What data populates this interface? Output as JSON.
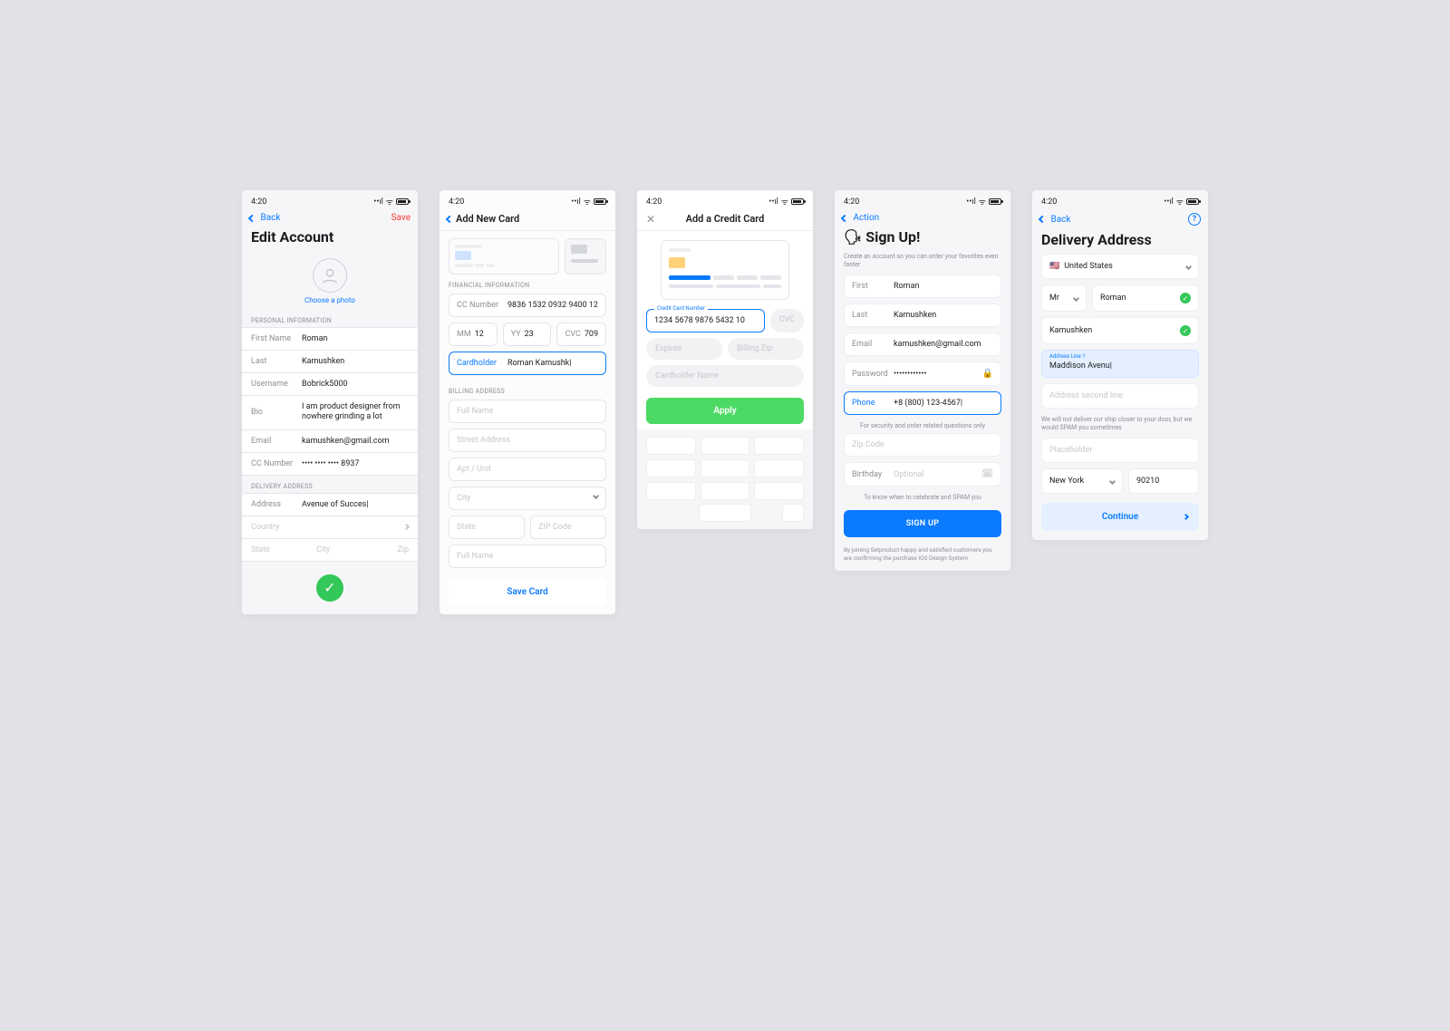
{
  "statusbar": {
    "time": "4:20",
    "signal": "▪▪▪▪",
    "wifi": "📶"
  },
  "edit_account": {
    "nav_back": "Back",
    "nav_save": "Save",
    "title": "Edit Account",
    "choose_photo": "Choose a photo",
    "section1": "PERSONAL INFORMATION",
    "rows": {
      "first_lbl": "First Name",
      "first_val": "Roman",
      "last_lbl": "Last",
      "last_val": "Kamushken",
      "user_lbl": "Username",
      "user_val": "Bobrick5000",
      "bio_lbl": "Bio",
      "bio_val": "I am product designer from nowhere grinding a lot",
      "email_lbl": "Email",
      "email_val": "kamushken@gmail.com",
      "cc_lbl": "CC Number",
      "cc_val": "•••• •••• •••• 8937"
    },
    "section2": "DELIVERY ADDRESS",
    "addr_lbl": "Address",
    "addr_val": "Avenue of Succes|",
    "country_lbl": "Country",
    "state_lbl": "State",
    "city_lbl": "City",
    "zip_lbl": "Zip"
  },
  "add_card": {
    "nav_title": "Add New Card",
    "section_fin": "FINANCIAL INFORMATION",
    "cc_lbl": "CC Number",
    "cc_val": "9836 1532 0932 9400 12",
    "mm_lbl": "MM",
    "mm_val": "12",
    "yy_lbl": "YY",
    "yy_val": "23",
    "cvc_lbl": "CVC",
    "cvc_val": "709",
    "holder_lbl": "Cardholder",
    "holder_val": "Roman Kamushk|",
    "section_bill": "BILLING ADDRESS",
    "bill": {
      "name": "Full Name",
      "street": "Street Address",
      "apt": "Apt / Unit",
      "city": "City",
      "state": "State",
      "zip": "ZIP Code",
      "name2": "Full Name"
    },
    "save": "Save Card"
  },
  "add_credit": {
    "nav_title": "Add a Credit Card",
    "cc_label": "Credit Card Number",
    "cc_val": "1234 5678 9876 5432 10",
    "cvc": "CVC",
    "exp": "Expires",
    "zip": "Billing Zip",
    "holder": "Cardholder Name",
    "apply": "Apply"
  },
  "signup": {
    "nav_action": "Action",
    "title": "🗣 Sign Up!",
    "sub": "Create an account so you can order your favorites even faster",
    "first_lbl": "First",
    "first_val": "Roman",
    "last_lbl": "Last",
    "last_val": "Kamushken",
    "email_lbl": "Email",
    "email_val": "kamushken@gmail.com",
    "pass_lbl": "Password",
    "pass_val": "••••••••••••",
    "phone_lbl": "Phone",
    "phone_val": "+8 (800) 123-4567|",
    "phone_hint": "For security and order related questions only",
    "zip_lbl": "Zip Code",
    "bday_lbl": "Birthday",
    "bday_ph": "Optional",
    "bday_hint": "To know when to celebrate and SPAM you",
    "cta": "SIGN UP",
    "foot": "By joining Setproduct happy and satisfied customers you are confirming the purchase iOS Design System"
  },
  "delivery": {
    "nav_back": "Back",
    "title": "Delivery Address",
    "country": "United States",
    "title_mr": "Mr",
    "first": "Roman",
    "last": "Kamushken",
    "addr_lbl": "Address Line 1",
    "addr_val": "Maddison Avenu|",
    "addr2": "Address second line",
    "note": "We will not deliver our ship closer to your door, but we would SPAM you sometimes",
    "placeholder": "Placeholder",
    "city": "New York",
    "zip": "90210",
    "continue": "Continue"
  }
}
